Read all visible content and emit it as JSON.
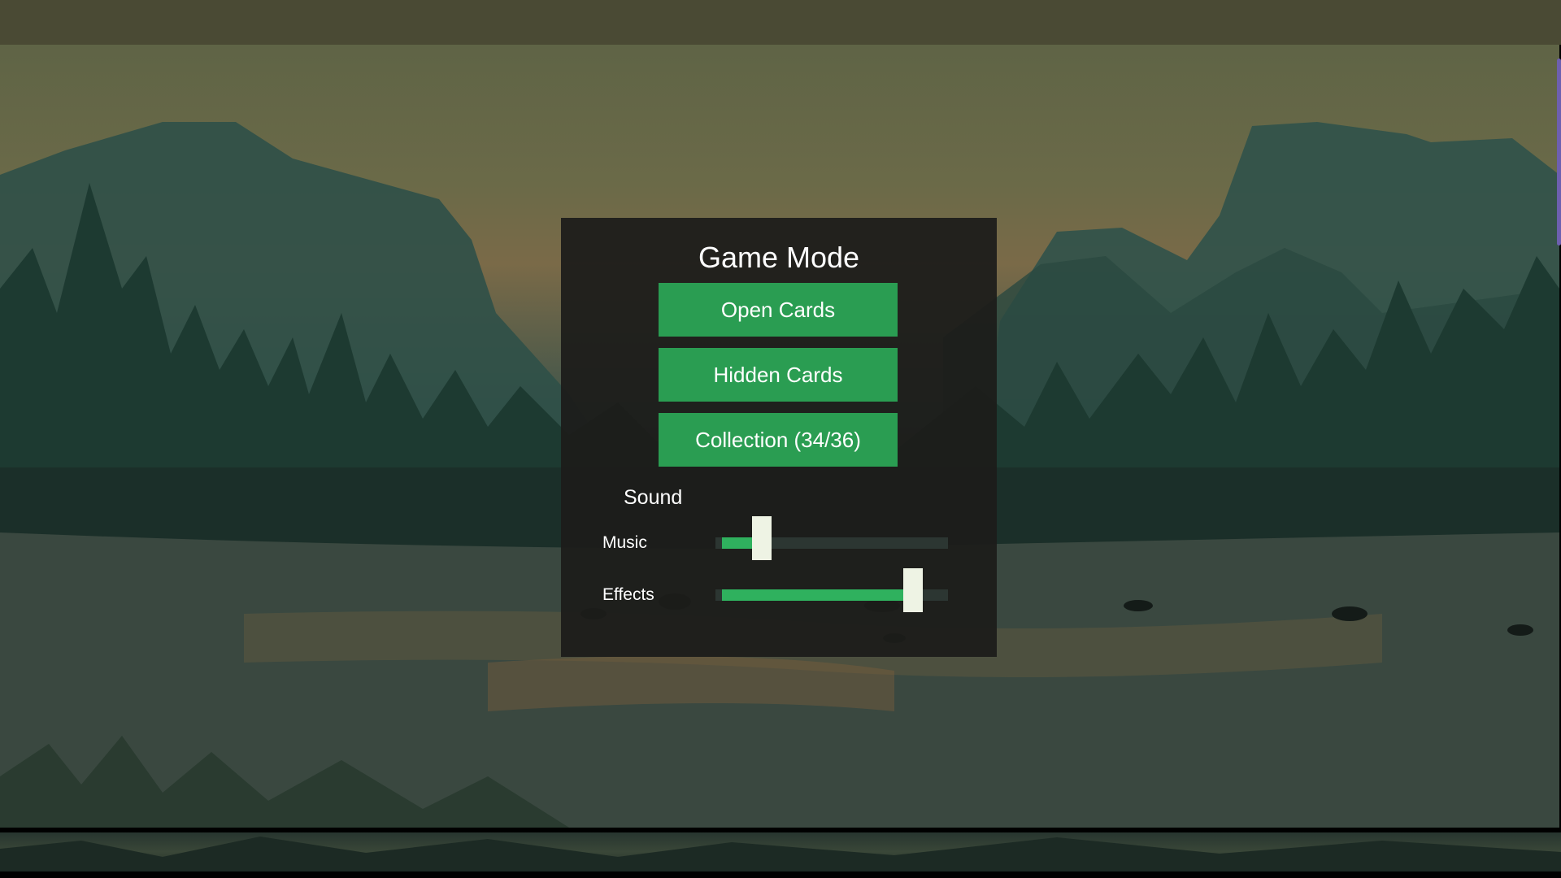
{
  "menu": {
    "title": "Game Mode",
    "buttons": {
      "open_cards": "Open Cards",
      "hidden_cards": "Hidden Cards",
      "collection": "Collection (34/36)"
    }
  },
  "sound": {
    "title": "Sound",
    "music": {
      "label": "Music",
      "level": 0.18
    },
    "effects": {
      "label": "Effects",
      "level": 0.87
    }
  },
  "colors": {
    "button": "#2a9d52",
    "slider_fill": "#2fb15e",
    "panel": "#1c1c1a",
    "thumb": "#eef3e4"
  }
}
